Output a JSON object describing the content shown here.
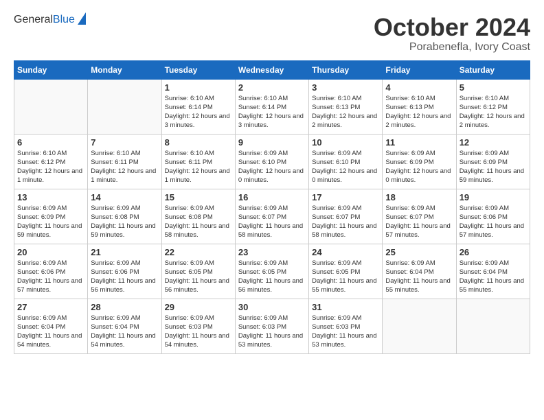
{
  "header": {
    "logo_general": "General",
    "logo_blue": "Blue",
    "month_title": "October 2024",
    "location": "Porabenefla, Ivory Coast"
  },
  "weekdays": [
    "Sunday",
    "Monday",
    "Tuesday",
    "Wednesday",
    "Thursday",
    "Friday",
    "Saturday"
  ],
  "days": [
    {
      "date": "",
      "sunrise": "",
      "sunset": "",
      "daylight": ""
    },
    {
      "date": "",
      "sunrise": "",
      "sunset": "",
      "daylight": ""
    },
    {
      "date": "1",
      "sunrise": "Sunrise: 6:10 AM",
      "sunset": "Sunset: 6:14 PM",
      "daylight": "Daylight: 12 hours and 3 minutes."
    },
    {
      "date": "2",
      "sunrise": "Sunrise: 6:10 AM",
      "sunset": "Sunset: 6:14 PM",
      "daylight": "Daylight: 12 hours and 3 minutes."
    },
    {
      "date": "3",
      "sunrise": "Sunrise: 6:10 AM",
      "sunset": "Sunset: 6:13 PM",
      "daylight": "Daylight: 12 hours and 2 minutes."
    },
    {
      "date": "4",
      "sunrise": "Sunrise: 6:10 AM",
      "sunset": "Sunset: 6:13 PM",
      "daylight": "Daylight: 12 hours and 2 minutes."
    },
    {
      "date": "5",
      "sunrise": "Sunrise: 6:10 AM",
      "sunset": "Sunset: 6:12 PM",
      "daylight": "Daylight: 12 hours and 2 minutes."
    },
    {
      "date": "6",
      "sunrise": "Sunrise: 6:10 AM",
      "sunset": "Sunset: 6:12 PM",
      "daylight": "Daylight: 12 hours and 1 minute."
    },
    {
      "date": "7",
      "sunrise": "Sunrise: 6:10 AM",
      "sunset": "Sunset: 6:11 PM",
      "daylight": "Daylight: 12 hours and 1 minute."
    },
    {
      "date": "8",
      "sunrise": "Sunrise: 6:10 AM",
      "sunset": "Sunset: 6:11 PM",
      "daylight": "Daylight: 12 hours and 1 minute."
    },
    {
      "date": "9",
      "sunrise": "Sunrise: 6:09 AM",
      "sunset": "Sunset: 6:10 PM",
      "daylight": "Daylight: 12 hours and 0 minutes."
    },
    {
      "date": "10",
      "sunrise": "Sunrise: 6:09 AM",
      "sunset": "Sunset: 6:10 PM",
      "daylight": "Daylight: 12 hours and 0 minutes."
    },
    {
      "date": "11",
      "sunrise": "Sunrise: 6:09 AM",
      "sunset": "Sunset: 6:09 PM",
      "daylight": "Daylight: 12 hours and 0 minutes."
    },
    {
      "date": "12",
      "sunrise": "Sunrise: 6:09 AM",
      "sunset": "Sunset: 6:09 PM",
      "daylight": "Daylight: 11 hours and 59 minutes."
    },
    {
      "date": "13",
      "sunrise": "Sunrise: 6:09 AM",
      "sunset": "Sunset: 6:09 PM",
      "daylight": "Daylight: 11 hours and 59 minutes."
    },
    {
      "date": "14",
      "sunrise": "Sunrise: 6:09 AM",
      "sunset": "Sunset: 6:08 PM",
      "daylight": "Daylight: 11 hours and 59 minutes."
    },
    {
      "date": "15",
      "sunrise": "Sunrise: 6:09 AM",
      "sunset": "Sunset: 6:08 PM",
      "daylight": "Daylight: 11 hours and 58 minutes."
    },
    {
      "date": "16",
      "sunrise": "Sunrise: 6:09 AM",
      "sunset": "Sunset: 6:07 PM",
      "daylight": "Daylight: 11 hours and 58 minutes."
    },
    {
      "date": "17",
      "sunrise": "Sunrise: 6:09 AM",
      "sunset": "Sunset: 6:07 PM",
      "daylight": "Daylight: 11 hours and 58 minutes."
    },
    {
      "date": "18",
      "sunrise": "Sunrise: 6:09 AM",
      "sunset": "Sunset: 6:07 PM",
      "daylight": "Daylight: 11 hours and 57 minutes."
    },
    {
      "date": "19",
      "sunrise": "Sunrise: 6:09 AM",
      "sunset": "Sunset: 6:06 PM",
      "daylight": "Daylight: 11 hours and 57 minutes."
    },
    {
      "date": "20",
      "sunrise": "Sunrise: 6:09 AM",
      "sunset": "Sunset: 6:06 PM",
      "daylight": "Daylight: 11 hours and 57 minutes."
    },
    {
      "date": "21",
      "sunrise": "Sunrise: 6:09 AM",
      "sunset": "Sunset: 6:06 PM",
      "daylight": "Daylight: 11 hours and 56 minutes."
    },
    {
      "date": "22",
      "sunrise": "Sunrise: 6:09 AM",
      "sunset": "Sunset: 6:05 PM",
      "daylight": "Daylight: 11 hours and 56 minutes."
    },
    {
      "date": "23",
      "sunrise": "Sunrise: 6:09 AM",
      "sunset": "Sunset: 6:05 PM",
      "daylight": "Daylight: 11 hours and 56 minutes."
    },
    {
      "date": "24",
      "sunrise": "Sunrise: 6:09 AM",
      "sunset": "Sunset: 6:05 PM",
      "daylight": "Daylight: 11 hours and 55 minutes."
    },
    {
      "date": "25",
      "sunrise": "Sunrise: 6:09 AM",
      "sunset": "Sunset: 6:04 PM",
      "daylight": "Daylight: 11 hours and 55 minutes."
    },
    {
      "date": "26",
      "sunrise": "Sunrise: 6:09 AM",
      "sunset": "Sunset: 6:04 PM",
      "daylight": "Daylight: 11 hours and 55 minutes."
    },
    {
      "date": "27",
      "sunrise": "Sunrise: 6:09 AM",
      "sunset": "Sunset: 6:04 PM",
      "daylight": "Daylight: 11 hours and 54 minutes."
    },
    {
      "date": "28",
      "sunrise": "Sunrise: 6:09 AM",
      "sunset": "Sunset: 6:04 PM",
      "daylight": "Daylight: 11 hours and 54 minutes."
    },
    {
      "date": "29",
      "sunrise": "Sunrise: 6:09 AM",
      "sunset": "Sunset: 6:03 PM",
      "daylight": "Daylight: 11 hours and 54 minutes."
    },
    {
      "date": "30",
      "sunrise": "Sunrise: 6:09 AM",
      "sunset": "Sunset: 6:03 PM",
      "daylight": "Daylight: 11 hours and 53 minutes."
    },
    {
      "date": "31",
      "sunrise": "Sunrise: 6:09 AM",
      "sunset": "Sunset: 6:03 PM",
      "daylight": "Daylight: 11 hours and 53 minutes."
    }
  ]
}
